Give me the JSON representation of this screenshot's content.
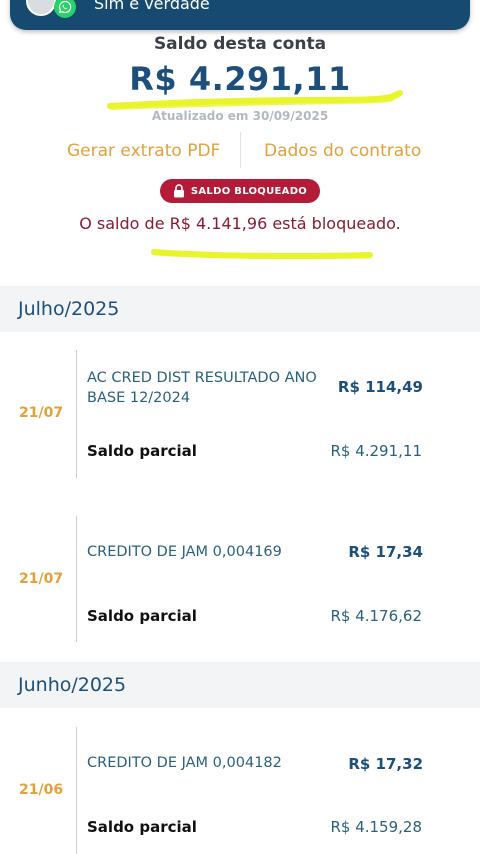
{
  "banner": {
    "text": "Sim é verdade"
  },
  "account": {
    "title": "Saldo desta conta",
    "balance": "R$ 4.291,11",
    "updated": "Atualizado em 30/09/2025"
  },
  "actions": {
    "pdf": "Gerar extrato PDF",
    "contract": "Dados do contrato"
  },
  "blocked": {
    "badge": "SALDO BLOQUEADO",
    "message": "O saldo de R$ 4.141,96 está bloqueado."
  },
  "months": [
    {
      "label": "Julho/2025",
      "transactions": [
        {
          "date": "21/07",
          "description": "AC CRED DIST RESULTADO ANO BASE 12/2024",
          "value": "R$ 114,49",
          "partial_label": "Saldo parcial",
          "partial_value": "R$ 4.291,11"
        },
        {
          "date": "21/07",
          "description": "CREDITO DE JAM 0,004169",
          "value": "R$ 17,34",
          "partial_label": "Saldo parcial",
          "partial_value": "R$ 4.176,62"
        }
      ]
    },
    {
      "label": "Junho/2025",
      "transactions": [
        {
          "date": "21/06",
          "description": "CREDITO DE JAM 0,004182",
          "value": "R$ 17,32",
          "partial_label": "Saldo parcial",
          "partial_value": "R$ 4.159,28"
        }
      ]
    }
  ],
  "colors": {
    "primary": "#1d4f7c",
    "accent": "#e6a03a",
    "danger": "#b31b39",
    "highlighter": "#e8f52a"
  },
  "icons": [
    "whatsapp-icon",
    "lock-icon"
  ]
}
